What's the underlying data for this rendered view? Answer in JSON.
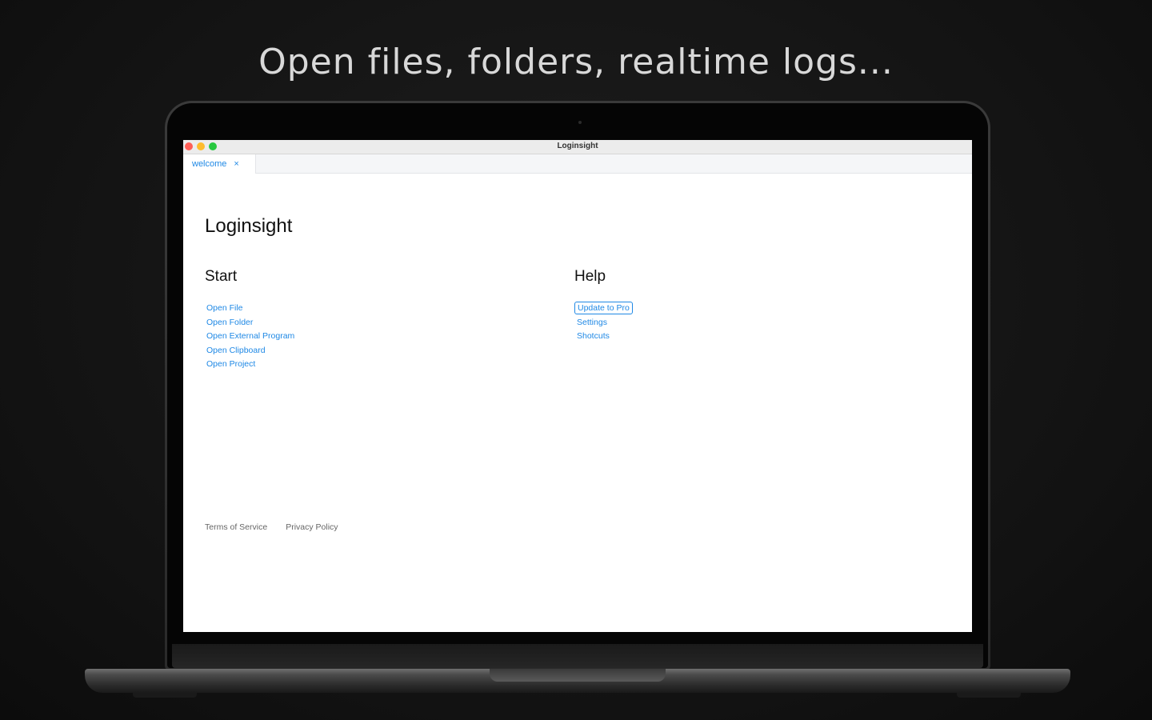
{
  "headline": "Open files, folders, realtime logs...",
  "window": {
    "title": "Loginsight"
  },
  "tabs": [
    {
      "label": "welcome",
      "close": "×"
    }
  ],
  "welcome": {
    "title": "Loginsight",
    "start": {
      "heading": "Start",
      "items": [
        "Open File",
        "Open Folder",
        "Open External Program",
        "Open Clipboard",
        "Open Project"
      ]
    },
    "help": {
      "heading": "Help",
      "items": [
        "Update to Pro",
        "Settings",
        "Shotcuts"
      ]
    },
    "footer": [
      "Terms of Service",
      "Privacy Policy"
    ]
  },
  "colors": {
    "accent": "#1e88e5",
    "close": "#ff5f57",
    "minimize": "#febc2e",
    "zoom": "#28c840"
  }
}
